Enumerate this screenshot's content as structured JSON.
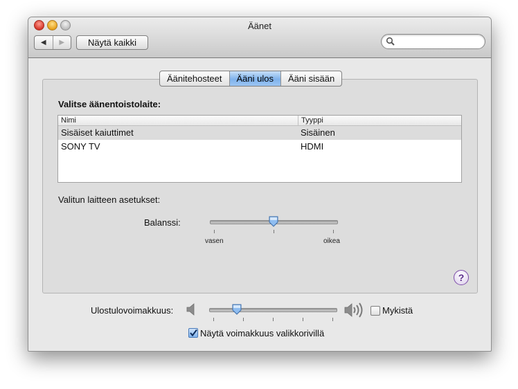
{
  "window": {
    "title": "Äänet"
  },
  "toolbar": {
    "back_icon": "chevron-left-icon",
    "forward_icon": "chevron-right-icon",
    "show_all_label": "Näytä kaikki",
    "search_placeholder": "",
    "search_value": ""
  },
  "tabs": [
    {
      "label": "Äänitehosteet",
      "active": false
    },
    {
      "label": "Ääni ulos",
      "active": true
    },
    {
      "label": "Ääni sisään",
      "active": false
    }
  ],
  "output": {
    "section_title": "Valitse äänentoistolaite:",
    "columns": [
      "Nimi",
      "Tyyppi"
    ],
    "devices": [
      {
        "name": "Sisäiset kaiuttimet",
        "type": "Sisäinen",
        "selected": true
      },
      {
        "name": "SONY TV",
        "type": "HDMI",
        "selected": false
      }
    ],
    "settings_label": "Valitun laitteen asetukset:",
    "balance": {
      "label": "Balanssi:",
      "left_label": "vasen",
      "right_label": "oikea",
      "value_fraction": 0.5
    }
  },
  "help": {
    "glyph": "?"
  },
  "volume": {
    "label": "Ulostulovoimakkuus:",
    "value_fraction": 0.2,
    "mute_label": "Mykistä",
    "mute_checked": false,
    "show_in_menubar_label": "Näytä voimakkuus valikkorivillä",
    "show_in_menubar_checked": true
  },
  "colors": {
    "selection_blue": "#7fb2ec",
    "help_purple": "#7c4ca8"
  }
}
